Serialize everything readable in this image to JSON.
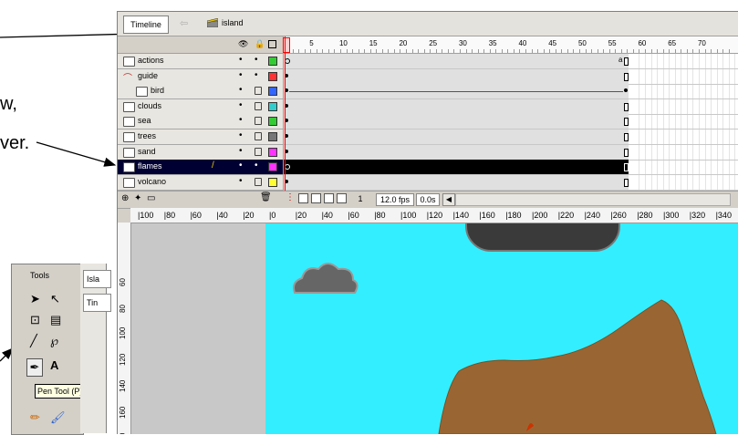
{
  "doc": {
    "line1": "w,",
    "line2": "ver."
  },
  "flash": {
    "tab_label": "Timeline",
    "scene_name": "island",
    "ruler_numbers": [
      "1",
      "5",
      "10",
      "15",
      "20",
      "25",
      "30",
      "35",
      "40",
      "45",
      "50",
      "55",
      "60",
      "65",
      "70"
    ],
    "layers": [
      {
        "name": "actions",
        "color": "#33cc33",
        "type": "normal"
      },
      {
        "name": "guide",
        "color": "#ff3333",
        "type": "guide"
      },
      {
        "name": "bird",
        "color": "#3366ff",
        "type": "guided"
      },
      {
        "name": "clouds",
        "color": "#33cccc",
        "type": "normal"
      },
      {
        "name": "sea",
        "color": "#33cc33",
        "type": "normal"
      },
      {
        "name": "trees",
        "color": "#777777",
        "type": "normal"
      },
      {
        "name": "sand",
        "color": "#ff33ff",
        "type": "normal"
      },
      {
        "name": "flames",
        "color": "#ff33ff",
        "type": "normal",
        "selected": true
      },
      {
        "name": "volcano",
        "color": "#ffff33",
        "type": "normal"
      }
    ],
    "status": {
      "frame": "1",
      "fps": "12.0 fps",
      "time": "0.0s"
    },
    "stage_ruler_numbers": [
      "100",
      "80",
      "60",
      "40",
      "20",
      "0",
      "20",
      "40",
      "60",
      "80",
      "100",
      "120",
      "140",
      "160",
      "180",
      "200",
      "220",
      "240",
      "260",
      "280",
      "300",
      "320",
      "340",
      "3"
    ],
    "stage_vruler_numbers": [
      "60",
      "80",
      "100",
      "120",
      "140",
      "160",
      "180"
    ]
  },
  "tools": {
    "title": "Tools",
    "tooltip": "Pen Tool (P)",
    "side_tab1": "Isla",
    "side_tab2": "Tin"
  },
  "colors": {
    "stage": "#33eeff",
    "cloud": "#666666",
    "island": "#996633",
    "oval": "#3a3a3a",
    "selected_row": "#000033"
  }
}
